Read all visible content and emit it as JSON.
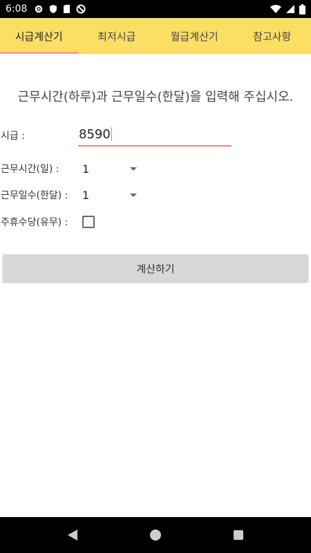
{
  "status_bar": {
    "time": "6:08"
  },
  "tabs": [
    {
      "label": "시급계산기",
      "active": true
    },
    {
      "label": "최저시급",
      "active": false
    },
    {
      "label": "월급계산기",
      "active": false
    },
    {
      "label": "참고사항",
      "active": false
    }
  ],
  "form": {
    "instruction": "근무시간(하루)과 근무일수(한달)을 입력해 주십시오.",
    "wage_label": "시급 :",
    "wage_value": "8590",
    "hours_label": "근무시간(일) :",
    "hours_value": "1",
    "days_label": "근무일수(한달) :",
    "days_value": "1",
    "holiday_pay_label": "주휴수당(유무) :",
    "holiday_pay_checked": false,
    "calculate_label": "계산하기"
  },
  "colors": {
    "tab_bar": "#fbde64",
    "accent": "#f08080"
  }
}
